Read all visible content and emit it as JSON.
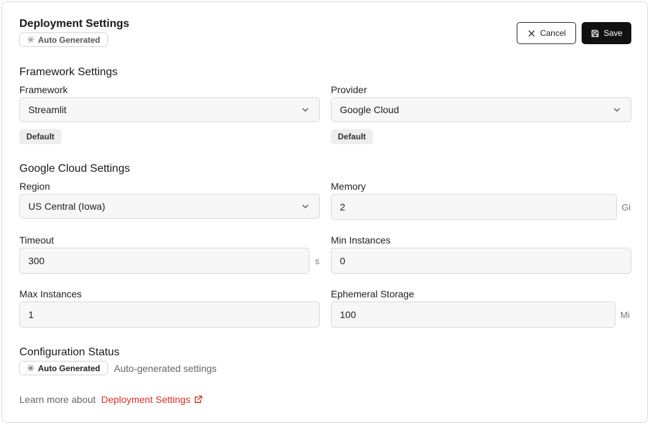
{
  "header": {
    "title": "Deployment Settings",
    "badge": "Auto Generated",
    "cancel_label": "Cancel",
    "save_label": "Save"
  },
  "framework_settings": {
    "title": "Framework Settings",
    "framework": {
      "label": "Framework",
      "value": "Streamlit",
      "badge": "Default"
    },
    "provider": {
      "label": "Provider",
      "value": "Google Cloud",
      "badge": "Default"
    }
  },
  "cloud_settings": {
    "title": "Google Cloud Settings",
    "region": {
      "label": "Region",
      "value": "US Central (Iowa)"
    },
    "memory": {
      "label": "Memory",
      "value": "2",
      "unit": "Gi"
    },
    "timeout": {
      "label": "Timeout",
      "value": "300",
      "unit": "s"
    },
    "min_instances": {
      "label": "Min Instances",
      "value": "0"
    },
    "max_instances": {
      "label": "Max Instances",
      "value": "1"
    },
    "ephemeral_storage": {
      "label": "Ephemeral Storage",
      "value": "100",
      "unit": "Mi"
    }
  },
  "config_status": {
    "title": "Configuration Status",
    "badge": "Auto Generated",
    "description": "Auto-generated settings"
  },
  "footer": {
    "prefix": "Learn more about",
    "link_label": "Deployment Settings"
  },
  "colors": {
    "accent_link": "#d92d20",
    "save_bg": "#111111",
    "field_bg": "#f7f7f7"
  },
  "icons": {
    "badge": "gear-icon",
    "cancel": "close-icon",
    "save": "save-icon",
    "select": "chevron-down-icon",
    "link": "external-link-icon"
  }
}
